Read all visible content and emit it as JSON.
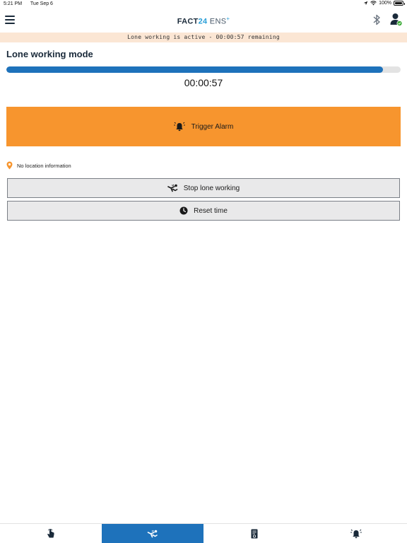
{
  "status_bar": {
    "time": "5:21 PM",
    "date": "Tue Sep 6",
    "battery": "100%"
  },
  "header": {
    "brand_part1": "FACT",
    "brand_part2": "24",
    "brand_part3": " ENS",
    "brand_sup": "+",
    "menu_icon": "hamburger-menu-icon",
    "bluetooth_icon": "bluetooth-icon",
    "profile_icon": "user-profile-icon",
    "profile_status_color": "#3aaa35"
  },
  "banner": {
    "text": "Lone working is active - 00:00:57 remaining",
    "background": "#fbe6d4"
  },
  "main": {
    "title": "Lone working mode",
    "progress_fraction": 0.955,
    "timer": "00:00:57",
    "alarm_button": {
      "label": "Trigger Alarm",
      "icon": "alarm-bell-icon",
      "color": "#f7952e"
    },
    "location": {
      "text": "No location information",
      "icon": "location-pin-icon",
      "icon_color": "#f7952e"
    },
    "stop_button": {
      "label": "Stop lone working",
      "icon": "person-falling-icon"
    },
    "reset_button": {
      "label": "Reset time",
      "icon": "clock-icon"
    }
  },
  "tabs": [
    {
      "icon": "hand-tap-icon",
      "active": false
    },
    {
      "icon": "lone-worker-icon",
      "active": true
    },
    {
      "icon": "document-icon",
      "active": false
    },
    {
      "icon": "alarm-bell-icon",
      "active": false
    }
  ],
  "colors": {
    "accent": "#1e72bb",
    "alarm": "#f7952e",
    "text": "#1a2a3a"
  }
}
